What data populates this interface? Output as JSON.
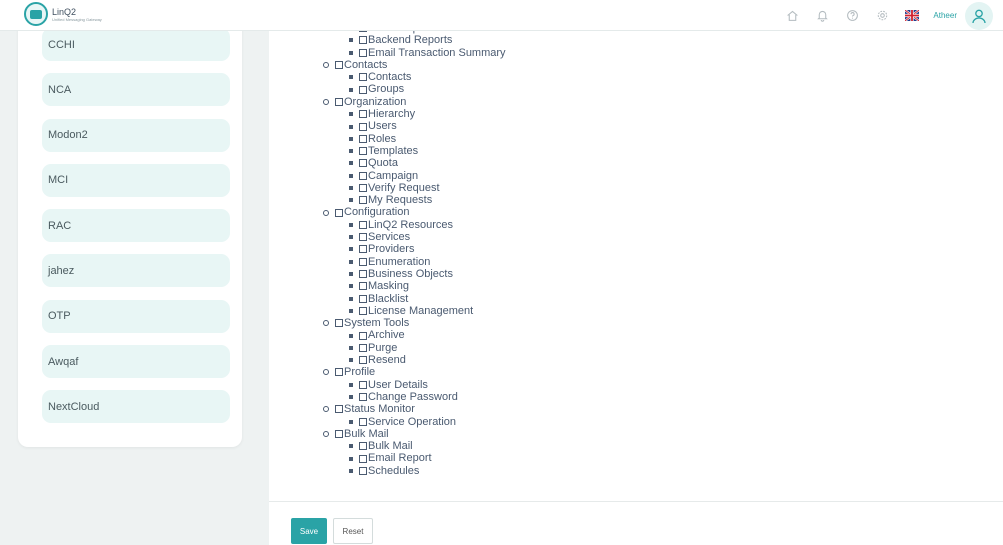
{
  "app": {
    "logo_name": "LinQ2",
    "logo_tagline": "Unified Messaging Gateway"
  },
  "header": {
    "icons": [
      "home-icon",
      "bell-icon",
      "help-icon",
      "gear-icon"
    ],
    "language_flag": "uk-flag-icon",
    "username": "Atheer"
  },
  "clients": [
    "CCHI",
    "NCA",
    "Modon2",
    "MCI",
    "RAC",
    "jahez",
    "OTP",
    "Awqaf",
    "NextCloud"
  ],
  "permissions": [
    {
      "label": "",
      "children": [
        "Email Report",
        "Backend Reports",
        "Email Transaction Summary"
      ],
      "partial": true
    },
    {
      "label": "Contacts",
      "children": [
        "Contacts",
        "Groups"
      ]
    },
    {
      "label": "Organization",
      "children": [
        "Hierarchy",
        "Users",
        "Roles",
        "Templates",
        "Quota",
        "Campaign",
        "Verify Request",
        "My Requests"
      ]
    },
    {
      "label": "Configuration",
      "children": [
        "LinQ2 Resources",
        "Services",
        "Providers",
        "Enumeration",
        "Business Objects",
        "Masking",
        "Blacklist",
        "License Management"
      ]
    },
    {
      "label": "System Tools",
      "children": [
        "Archive",
        "Purge",
        "Resend"
      ]
    },
    {
      "label": "Profile",
      "children": [
        "User Details",
        "Change Password"
      ]
    },
    {
      "label": "Status Monitor",
      "children": [
        "Service Operation"
      ]
    },
    {
      "label": "Bulk Mail",
      "children": [
        "Bulk Mail",
        "Email Report",
        "Schedules"
      ]
    }
  ],
  "actions": {
    "save_label": "Save",
    "reset_label": "Reset"
  },
  "colors": {
    "accent": "#2aa3a6",
    "client_item_bg": "#e8f6f5",
    "page_bg": "#eef2f2"
  }
}
